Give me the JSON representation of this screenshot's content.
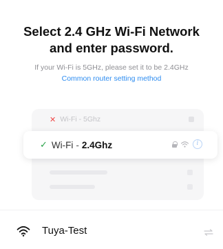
{
  "header": {
    "title_line1": "Select 2.4 GHz Wi-Fi Network",
    "title_line2": "and enter password."
  },
  "hint": {
    "text": "If your Wi-Fi is 5GHz, please set it to be 2.4GHz",
    "link": "Common router setting method"
  },
  "illustration": {
    "bad_network": {
      "icon": "cross-icon",
      "label": "Wi-Fi - 5Ghz"
    },
    "good_network": {
      "icon": "check-icon",
      "prefix": "Wi-Fi",
      "separator": "-",
      "band": "2.4Ghz",
      "status_icons": [
        "lock-icon",
        "wifi-icon",
        "info-icon"
      ]
    }
  },
  "selected_network": {
    "icon": "wifi-icon",
    "ssid": "Tuya-Test",
    "action_icon": "swap-icon"
  },
  "colors": {
    "accent": "#2d8cf0",
    "check": "#2aa34a",
    "cross": "#f04848"
  }
}
